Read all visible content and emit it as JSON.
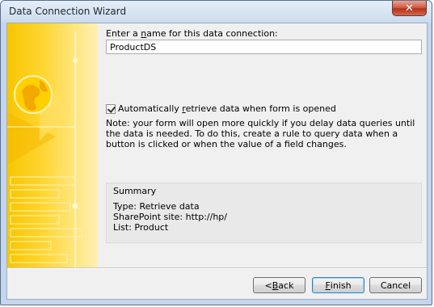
{
  "window": {
    "title": "Data Connection Wizard",
    "close_glyph": "✕"
  },
  "form": {
    "name_label_prefix": "Enter a ",
    "name_label_mnemonic": "n",
    "name_label_suffix": "ame for this data connection:",
    "name_value": "ProductDS",
    "auto_retrieve_checked": true,
    "auto_retrieve_prefix": "Automatically ",
    "auto_retrieve_mnemonic": "r",
    "auto_retrieve_suffix": "etrieve data when form is opened",
    "note": "Note: your form will open more quickly if you delay data queries until the data is needed. To do this, create a rule to query data when a button is clicked or when the value of a field changes."
  },
  "summary": {
    "heading": "Summary",
    "lines": [
      "Type: Retrieve data",
      "SharePoint site: http://hp/",
      "List: Product"
    ]
  },
  "buttons": {
    "back_prefix": "< ",
    "back_mnemonic": "B",
    "back_suffix": "ack",
    "finish_mnemonic": "F",
    "finish_suffix": "inish",
    "cancel": "Cancel"
  }
}
